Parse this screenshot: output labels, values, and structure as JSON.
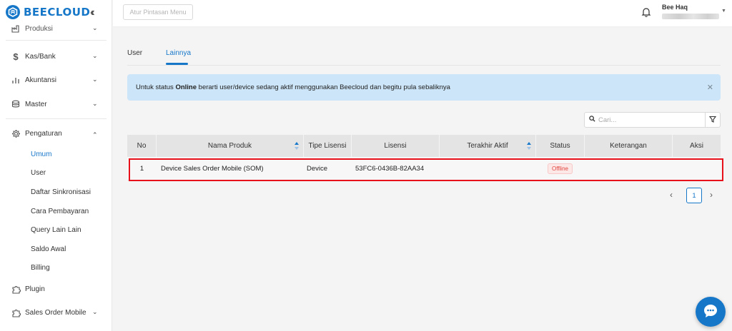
{
  "brand": {
    "name": "BEECLOUD",
    "color": "#1677c9"
  },
  "header": {
    "shortcut_placeholder": "Atur Pintasan Menu",
    "user_name": "Bee Haq"
  },
  "sidebar": {
    "items": [
      {
        "label": "Produksi",
        "icon": "factory-icon"
      },
      {
        "label": "Kas/Bank",
        "icon": "dollar-icon"
      },
      {
        "label": "Akuntansi",
        "icon": "bar-chart-icon"
      },
      {
        "label": "Master",
        "icon": "database-icon"
      },
      {
        "label": "Pengaturan",
        "icon": "gear-icon",
        "expanded": true
      },
      {
        "label": "Plugin",
        "icon": "puzzle-icon"
      },
      {
        "label": "Sales Order Mobile",
        "icon": "puzzle-icon"
      }
    ],
    "submenu": [
      {
        "label": "Umum",
        "active": true
      },
      {
        "label": "User"
      },
      {
        "label": "Daftar Sinkronisasi"
      },
      {
        "label": "Cara Pembayaran"
      },
      {
        "label": "Query Lain Lain"
      },
      {
        "label": "Saldo Awal"
      },
      {
        "label": "Billing"
      }
    ]
  },
  "tabs": [
    {
      "label": "User",
      "active": false
    },
    {
      "label": "Lainnya",
      "active": true
    }
  ],
  "alert": {
    "prefix": "Untuk status ",
    "bold": "Online",
    "suffix": " berarti user/device sedang aktif menggunakan Beecloud dan begitu pula sebaliknya"
  },
  "search": {
    "placeholder": "Cari..."
  },
  "table": {
    "columns": [
      "No",
      "Nama Produk",
      "Tipe Lisensi",
      "Lisensi",
      "Terakhir Aktif",
      "Status",
      "Keterangan",
      "Aksi"
    ],
    "rows": [
      {
        "no": "1",
        "nama_produk": "Device Sales Order Mobile (SOM)",
        "tipe_lisensi": "Device",
        "lisensi": "53FC6-0436B-82AA34",
        "terakhir_aktif": "",
        "status": "Offline",
        "keterangan": "",
        "aksi": ""
      }
    ]
  },
  "pagination": {
    "current": "1",
    "prev": "‹",
    "next": "›"
  },
  "colors": {
    "accent": "#1677c9",
    "highlight": "#e8101a",
    "offline": "#e0463f",
    "alert_bg": "#cce5f8"
  }
}
